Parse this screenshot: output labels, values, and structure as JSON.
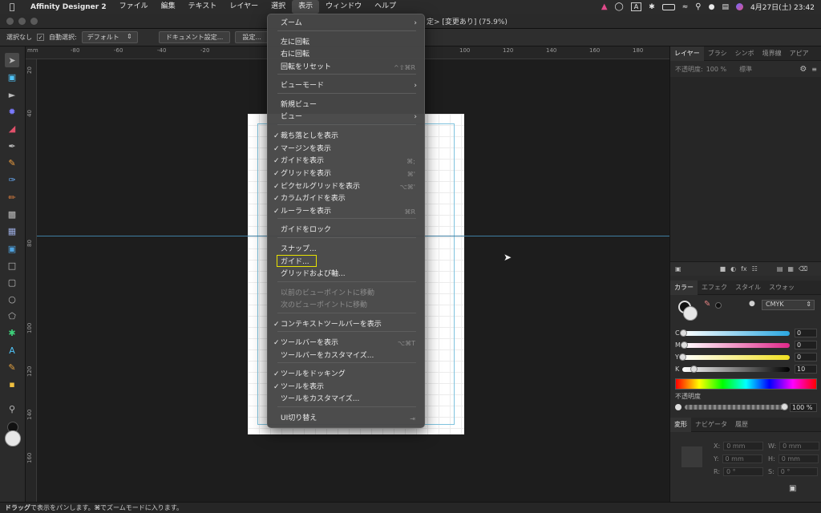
{
  "menubar": {
    "app": "Affinity Designer 2",
    "items": [
      "ファイル",
      "編集",
      "テキスト",
      "レイヤー",
      "選択",
      "表示",
      "ウィンドウ",
      "ヘルプ"
    ],
    "active_index": 5,
    "datetime": "4月27日(土)  23:42",
    "input_indicator": "A"
  },
  "window": {
    "title": "定> [変更あり] (75.9%)"
  },
  "context_toolbar": {
    "selection": "選択なし",
    "auto_select_label": "自動選択:",
    "auto_select_value": "デフォルト",
    "document_setup": "ドキュメント設定...",
    "settings": "設定..."
  },
  "ruler": {
    "unit": "mm",
    "h_labels": [
      "-80",
      "-60",
      "-40",
      "-20",
      "100",
      "120",
      "140",
      "160",
      "180",
      "200",
      "220"
    ],
    "v_labels": [
      "20",
      "40",
      "60",
      "80",
      "100",
      "120",
      "140",
      "160"
    ]
  },
  "view_menu": {
    "items": [
      {
        "label": "ズーム",
        "check": "",
        "shortcut": "",
        "submenu": true,
        "disabled": false
      },
      {
        "label": "左に回転",
        "check": "",
        "shortcut": "",
        "submenu": false,
        "disabled": false
      },
      {
        "label": "右に回転",
        "check": "",
        "shortcut": "",
        "submenu": false,
        "disabled": false
      },
      {
        "label": "回転をリセット",
        "check": "",
        "shortcut": "^⇧⌘R",
        "submenu": false,
        "disabled": false
      },
      {
        "label": "ビューモード",
        "check": "",
        "shortcut": "",
        "submenu": true,
        "disabled": false
      },
      {
        "label": "新規ビュー",
        "check": "",
        "shortcut": "",
        "submenu": false,
        "disabled": false
      },
      {
        "label": "ビュー",
        "check": "",
        "shortcut": "",
        "submenu": true,
        "disabled": false
      },
      {
        "label": "裁ち落としを表示",
        "check": "✓",
        "shortcut": "",
        "submenu": false,
        "disabled": false
      },
      {
        "label": "マージンを表示",
        "check": "✓",
        "shortcut": "",
        "submenu": false,
        "disabled": false
      },
      {
        "label": "ガイドを表示",
        "check": "✓",
        "shortcut": "⌘;",
        "submenu": false,
        "disabled": false
      },
      {
        "label": "グリッドを表示",
        "check": "✓",
        "shortcut": "⌘'",
        "submenu": false,
        "disabled": false
      },
      {
        "label": "ピクセルグリッドを表示",
        "check": "✓",
        "shortcut": "⌥⌘'",
        "submenu": false,
        "disabled": false
      },
      {
        "label": "カラムガイドを表示",
        "check": "✓",
        "shortcut": "",
        "submenu": false,
        "disabled": false
      },
      {
        "label": "ルーラーを表示",
        "check": "✓",
        "shortcut": "⌘R",
        "submenu": false,
        "disabled": false
      },
      {
        "label": "ガイドをロック",
        "check": "",
        "shortcut": "",
        "submenu": false,
        "disabled": false
      },
      {
        "label": "スナップ...",
        "check": "",
        "shortcut": "",
        "submenu": false,
        "disabled": false
      },
      {
        "label": "ガイド...",
        "check": "",
        "shortcut": "",
        "submenu": false,
        "disabled": false
      },
      {
        "label": "グリッドおよび軸...",
        "check": "",
        "shortcut": "",
        "submenu": false,
        "disabled": false
      },
      {
        "label": "以前のビューポイントに移動",
        "check": "",
        "shortcut": "",
        "submenu": false,
        "disabled": true
      },
      {
        "label": "次のビューポイントに移動",
        "check": "",
        "shortcut": "",
        "submenu": false,
        "disabled": true
      },
      {
        "label": "コンテキストツールバーを表示",
        "check": "✓",
        "shortcut": "",
        "submenu": false,
        "disabled": false
      },
      {
        "label": "ツールバーを表示",
        "check": "✓",
        "shortcut": "⌥⌘T",
        "submenu": false,
        "disabled": false
      },
      {
        "label": "ツールバーをカスタマイズ...",
        "check": "",
        "shortcut": "",
        "submenu": false,
        "disabled": false
      },
      {
        "label": "ツールをドッキング",
        "check": "✓",
        "shortcut": "",
        "submenu": false,
        "disabled": false
      },
      {
        "label": "ツールを表示",
        "check": "✓",
        "shortcut": "",
        "submenu": false,
        "disabled": false
      },
      {
        "label": "ツールをカスタマイズ...",
        "check": "",
        "shortcut": "",
        "submenu": false,
        "disabled": false
      },
      {
        "label": "UI切り替え",
        "check": "",
        "shortcut": "⇥",
        "submenu": false,
        "disabled": false
      }
    ],
    "highlighted": "ガイド..."
  },
  "layers_panel": {
    "tabs": [
      "レイヤー",
      "ブラシ",
      "シンボ",
      "境界線",
      "アピア"
    ],
    "opacity_label": "不透明度:",
    "opacity_value": "100 %",
    "blend_mode": "標準"
  },
  "color_panel": {
    "tabs": [
      "カラー",
      "エフェク",
      "スタイル",
      "スウォッ"
    ],
    "model": "CMYK",
    "channels": [
      {
        "name": "C",
        "value": "0",
        "fraction": 0.0
      },
      {
        "name": "M",
        "value": "0",
        "fraction": 0.0
      },
      {
        "name": "Y",
        "value": "0",
        "fraction": 0.0
      },
      {
        "name": "K",
        "value": "10",
        "fraction": 0.1
      }
    ],
    "opacity_label": "不透明度",
    "opacity_value": "100 %",
    "colors": {
      "c": "#2aa7e0",
      "m": "#e0288a",
      "y": "#f0e020"
    }
  },
  "transform_panel": {
    "tabs": [
      "変形",
      "ナビゲータ",
      "履歴"
    ],
    "fields": [
      {
        "label": "X:",
        "value": "0 mm"
      },
      {
        "label": "W:",
        "value": "0 mm"
      },
      {
        "label": "Y:",
        "value": "0 mm"
      },
      {
        "label": "H:",
        "value": "0 mm"
      },
      {
        "label": "R:",
        "value": "0 °"
      },
      {
        "label": "S:",
        "value": "0 °"
      }
    ]
  },
  "status": {
    "drag": "ドラッグ",
    "text1": "で表示をパンします。",
    "cmd": "⌘",
    "text2": "でズームモードに入ります。"
  }
}
